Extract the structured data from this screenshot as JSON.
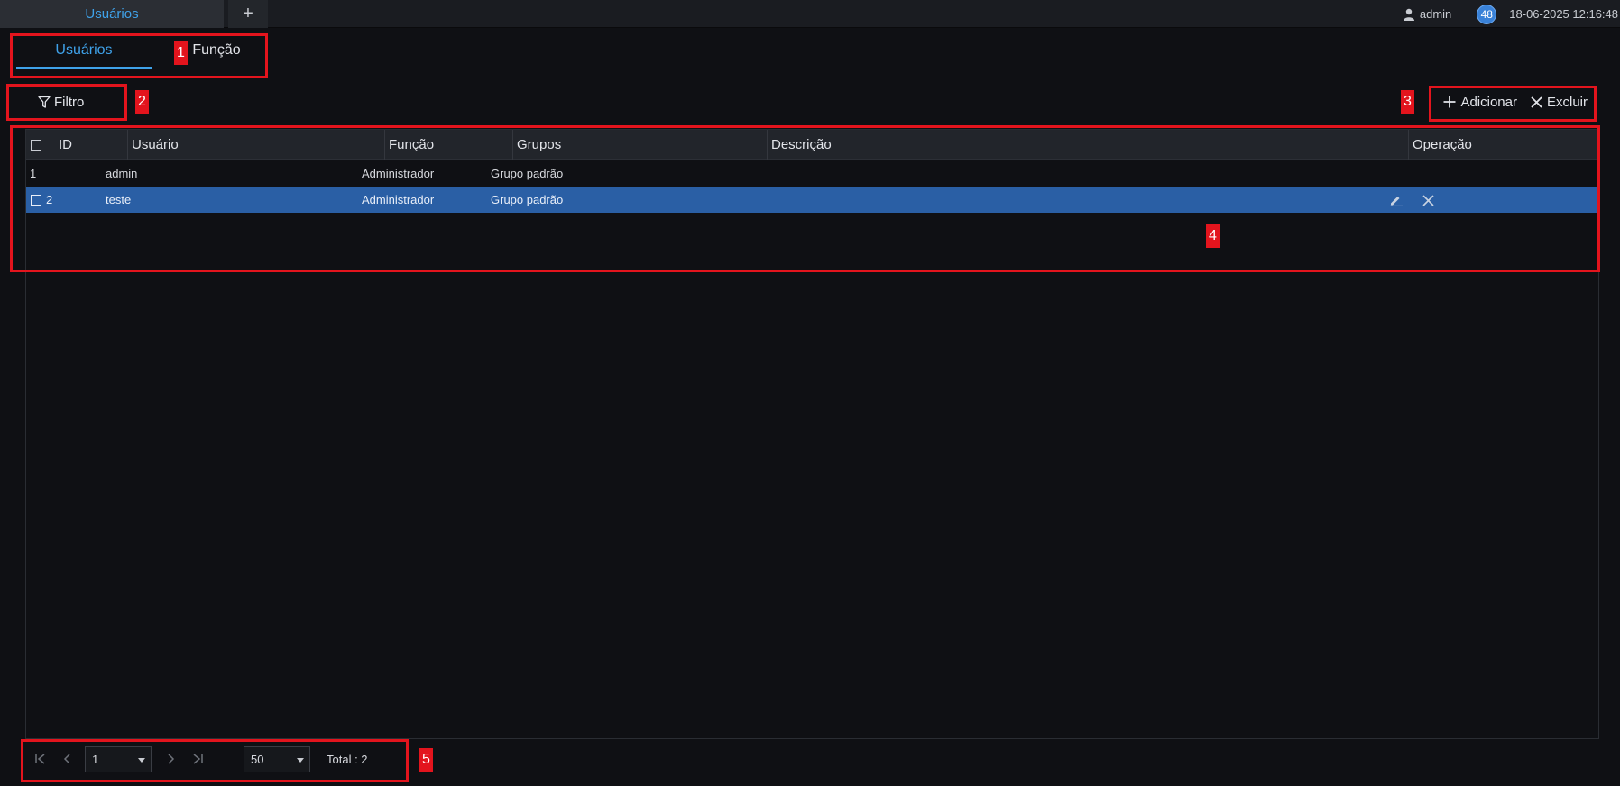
{
  "topbar": {
    "tab_label": "Usuários",
    "new_tab_symbol": "+",
    "user_name": "admin",
    "badge_count": "48",
    "datetime": "18-06-2025 12:16:48"
  },
  "tabs": [
    {
      "label": "Usuários",
      "active": true
    },
    {
      "label": "Função",
      "active": false
    }
  ],
  "toolbar": {
    "filter_label": "Filtro",
    "add_label": "Adicionar",
    "delete_label": "Excluir"
  },
  "table": {
    "columns": [
      "ID",
      "Usuário",
      "Função",
      "Grupos",
      "Descrição",
      "Operação"
    ],
    "rows": [
      {
        "id": "1",
        "user": "admin",
        "role": "Administrador",
        "groups": "Grupo padrão",
        "description": "",
        "selected": false
      },
      {
        "id": "2",
        "user": "teste",
        "role": "Administrador",
        "groups": "Grupo padrão",
        "description": "",
        "selected": true
      }
    ]
  },
  "pagination": {
    "page": "1",
    "page_size": "50",
    "total": "Total : 2"
  },
  "annotations": [
    "1",
    "2",
    "3",
    "4",
    "5"
  ],
  "colors": {
    "accent": "#3fa2ea",
    "selected_row": "#2a5fa5",
    "annotation": "#e3141d"
  }
}
